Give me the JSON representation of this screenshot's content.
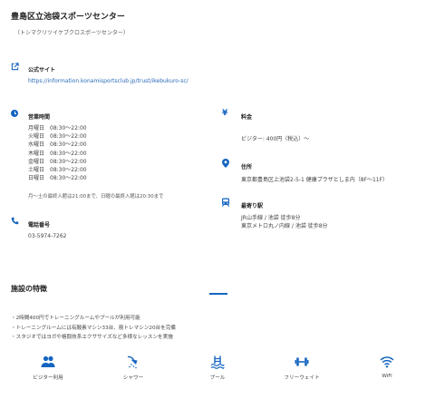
{
  "facility": {
    "title": "豊島区立池袋スポーツセンター",
    "subtitle": "（トシマクリツイケブクロスポーツセンター）"
  },
  "website": {
    "label": "公式サイト",
    "url": "https://information.konamisportsclub.jp/trust/ikebukuro-sc/"
  },
  "hours": {
    "label": "営業時間",
    "rows": [
      {
        "day": "月曜日",
        "time": "08:30～22:00"
      },
      {
        "day": "火曜日",
        "time": "08:30～22:00"
      },
      {
        "day": "水曜日",
        "time": "08:30～22:00"
      },
      {
        "day": "木曜日",
        "time": "08:30～22:00"
      },
      {
        "day": "金曜日",
        "time": "08:30～22:00"
      },
      {
        "day": "土曜日",
        "time": "08:30～22:00"
      },
      {
        "day": "日曜日",
        "time": "08:30～22:00"
      }
    ],
    "note": "月～土の最終入館は21:00まで、日曜の最終入館は20:30まで"
  },
  "phone": {
    "label": "電話番号",
    "value": "03-5974-7262"
  },
  "fee": {
    "icon": "yen-icon",
    "label": "料金",
    "value": "ビジター: 400円（税込）～"
  },
  "address": {
    "label": "住所",
    "value": "東京都豊島区上池袋2-5-1 健康プラザとしま内（8F～11F）"
  },
  "station": {
    "label": "最寄り駅",
    "lines": [
      "JR山手線 / 池袋 徒歩8分",
      "東京メトロ丸ノ内線 / 池袋 徒歩8分"
    ]
  },
  "features": {
    "title": "施設の特徴",
    "items": [
      "・2時間400円でトレーニングルームやプールが利用可能",
      "・トレーニングルームには有酸素マシン33台、筋トレマシン20台を完備",
      "・スタジオではヨガや格闘技系エクササイズなど多様なレッスンを実施"
    ]
  },
  "amenities": [
    {
      "icon": "people-icon",
      "label": "ビジター利用"
    },
    {
      "icon": "shower-icon",
      "label": "シャワー"
    },
    {
      "icon": "pool-icon",
      "label": "プール"
    },
    {
      "icon": "dumbbell-icon",
      "label": "フリーウェイト"
    },
    {
      "icon": "wifi-icon",
      "label": "WiFi"
    }
  ],
  "colors": {
    "accent": "#1565c0",
    "link": "#2a6cb8",
    "text": "#333333"
  }
}
